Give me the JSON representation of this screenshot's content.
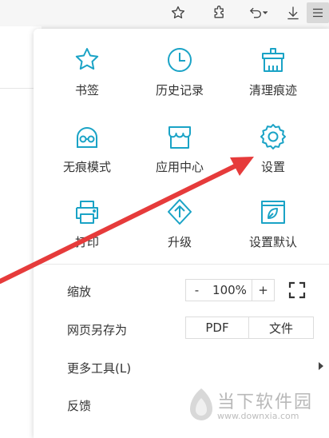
{
  "toolbar": {
    "icons": [
      "star-icon",
      "extension-icon",
      "undo-icon",
      "download-icon",
      "menu-icon"
    ]
  },
  "menu": {
    "grid": [
      {
        "label": "书签",
        "icon": "star-icon"
      },
      {
        "label": "历史记录",
        "icon": "clock-icon"
      },
      {
        "label": "清理痕迹",
        "icon": "broom-icon"
      },
      {
        "label": "无痕模式",
        "icon": "incognito-icon"
      },
      {
        "label": "应用中心",
        "icon": "store-icon"
      },
      {
        "label": "设置",
        "icon": "gear-icon"
      },
      {
        "label": "打印",
        "icon": "printer-icon"
      },
      {
        "label": "升级",
        "icon": "upgrade-icon"
      },
      {
        "label": "设置默认",
        "icon": "default-browser-icon"
      }
    ],
    "zoom": {
      "label": "缩放",
      "minus": "-",
      "value": "100%",
      "plus": "+"
    },
    "save_as": {
      "label": "网页另存为",
      "pdf": "PDF",
      "file": "文件"
    },
    "more_tools": {
      "label": "更多工具(L)"
    },
    "feedback": {
      "label": "反馈"
    }
  },
  "watermark": {
    "text": "当下软件园",
    "url": "www.downxia.com"
  },
  "colors": {
    "accent": "#1aa3c6",
    "arrow": "#e63b3b",
    "panel": "#ffffff"
  }
}
